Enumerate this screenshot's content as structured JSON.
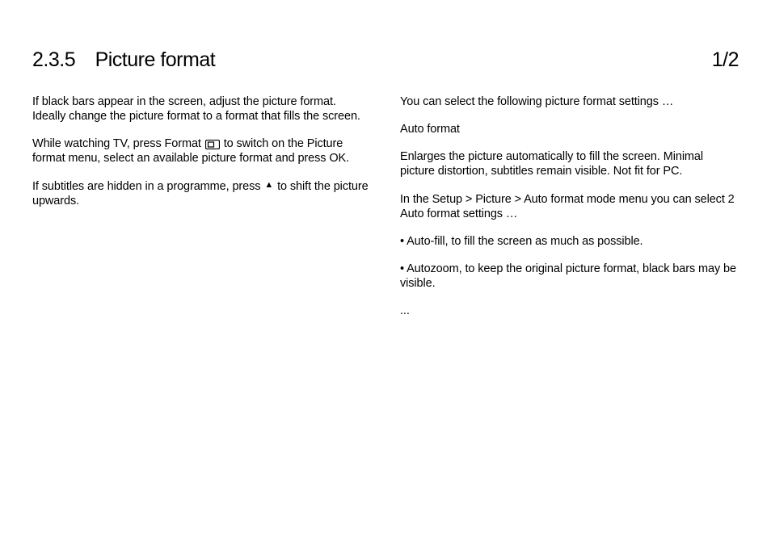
{
  "header": {
    "section_number": "2.3.5",
    "section_title": "Picture format",
    "page_indicator": "1/2"
  },
  "left_column": {
    "p1": "If black bars appear in the screen, adjust the picture format. Ideally change the picture format to a format that fills the screen.",
    "p2a": "While watching TV, press Format ",
    "p2b": " to switch on the Picture format menu, select an available picture format and press OK.",
    "p3a": "If subtitles are hidden in a programme, press ",
    "p3b": " to shift the picture upwards."
  },
  "right_column": {
    "p1": "You can select the following picture format settings …",
    "p2": "Auto format",
    "p3": "Enlarges the picture automatically to fill the screen. Minimal picture distortion, subtitles remain visible. Not fit for PC.",
    "p4": "In the Setup > Picture > Auto format mode menu you can select 2 Auto format settings …",
    "p5": "• Auto-fill, to fill the screen as much as possible.",
    "p6": "• Autozoom, to keep the original picture format, black bars may be visible.",
    "p7": "..."
  },
  "icons": {
    "format": "format-icon",
    "up": "▲"
  }
}
